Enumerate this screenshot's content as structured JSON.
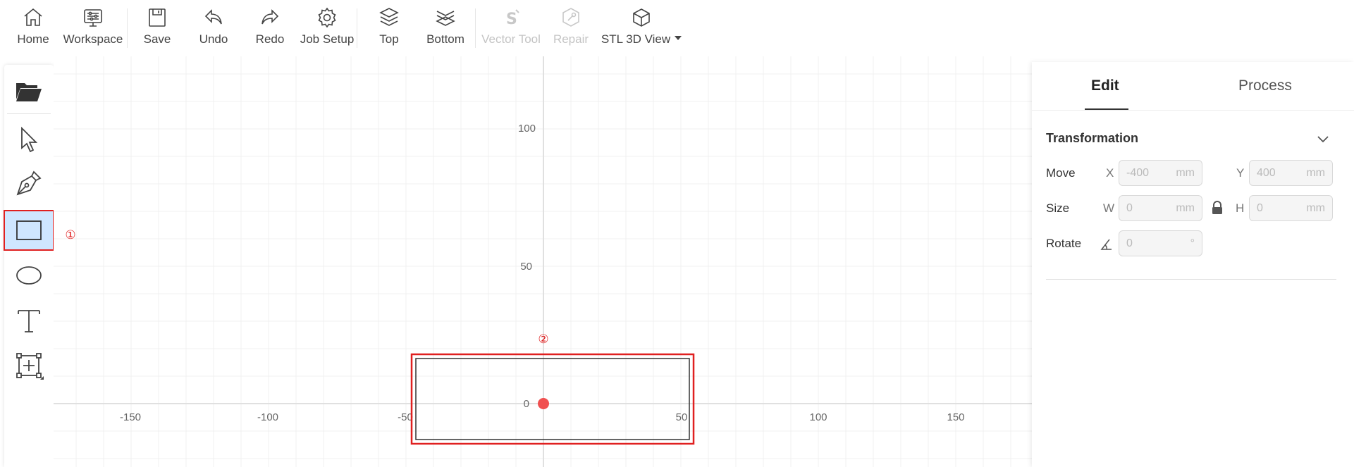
{
  "toolbar": {
    "home": "Home",
    "workspace": "Workspace",
    "save": "Save",
    "undo": "Undo",
    "redo": "Redo",
    "job_setup": "Job Setup",
    "top": "Top",
    "bottom": "Bottom",
    "vector_tool": "Vector Tool",
    "repair": "Repair",
    "stl_view": "STL 3D View"
  },
  "canvas": {
    "x_ticks": [
      "-150",
      "-100",
      "-50",
      "50",
      "100",
      "150"
    ],
    "y_ticks": [
      "100",
      "50",
      "0"
    ],
    "annotation_1": "①",
    "annotation_2": "②"
  },
  "right_panel": {
    "tab_edit": "Edit",
    "tab_process": "Process",
    "section_title": "Transformation",
    "move_label": "Move",
    "size_label": "Size",
    "rotate_label": "Rotate",
    "x_letter": "X",
    "y_letter": "Y",
    "w_letter": "W",
    "h_letter": "H",
    "move_x": {
      "placeholder": "-400",
      "unit": "mm"
    },
    "move_y": {
      "placeholder": "400",
      "unit": "mm"
    },
    "size_w": {
      "placeholder": "0",
      "unit": "mm"
    },
    "size_h": {
      "placeholder": "0",
      "unit": "mm"
    },
    "rotate": {
      "placeholder": "0",
      "unit": "°"
    }
  },
  "colors": {
    "accent_red": "#e02020",
    "selection_blue": "#cfe6ff",
    "origin_dot": "#f05050"
  }
}
